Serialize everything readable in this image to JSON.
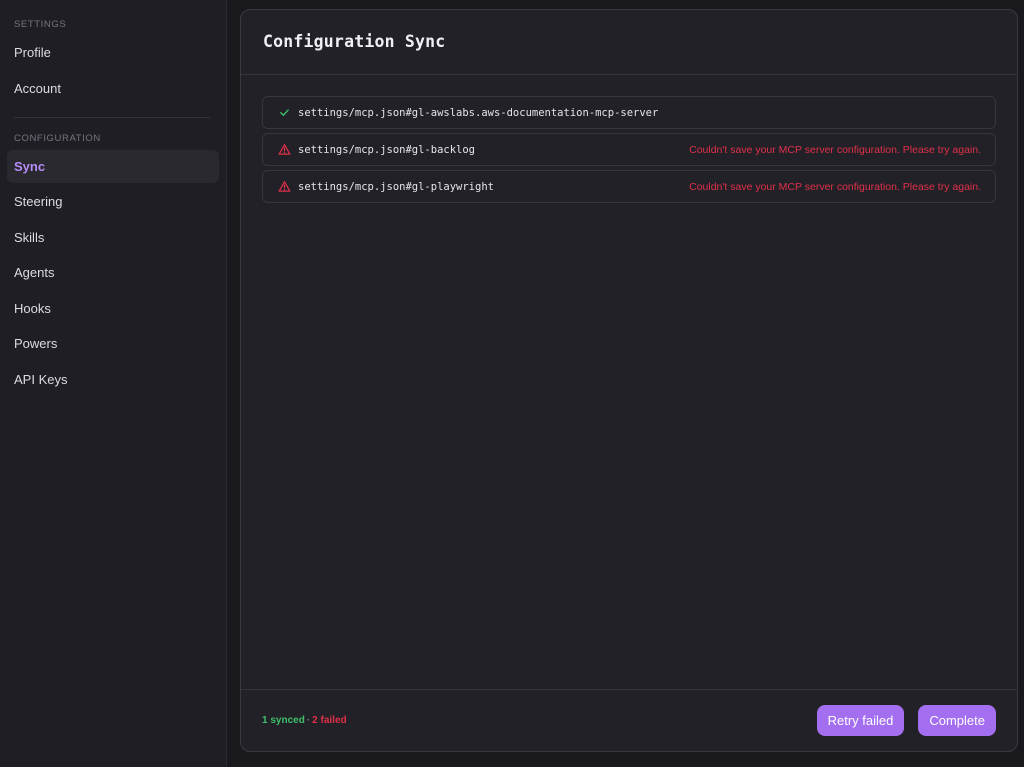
{
  "sidebar": {
    "sections": [
      {
        "label": "SETTINGS",
        "items": [
          "Profile",
          "Account"
        ]
      },
      {
        "label": "CONFIGURATION",
        "items": [
          "Sync",
          "Steering",
          "Skills",
          "Agents",
          "Hooks",
          "Powers",
          "API Keys"
        ]
      }
    ],
    "active_item": "Sync"
  },
  "panel": {
    "title": "Configuration Sync",
    "rows": [
      {
        "path": "settings/mcp.json#gl-awslabs.aws-documentation-mcp-server",
        "status": "success",
        "icon": "check-icon",
        "error": ""
      },
      {
        "path": "settings/mcp.json#gl-backlog",
        "status": "failed",
        "icon": "warning-triangle-icon",
        "error": "Couldn't save your MCP server configuration. Please try again."
      },
      {
        "path": "settings/mcp.json#gl-playwright",
        "status": "failed",
        "icon": "warning-triangle-icon",
        "error": "Couldn't save your MCP server configuration. Please try again."
      }
    ],
    "footer": {
      "synced_text": "1 synced",
      "separator": "·",
      "failed_text": "2 failed",
      "retry_label": "Retry failed",
      "complete_label": "Complete"
    }
  },
  "colors": {
    "accent": "#a46ef0",
    "active_nav": "#b58cf5",
    "success": "#3fbf6a",
    "error": "#e0304a"
  }
}
